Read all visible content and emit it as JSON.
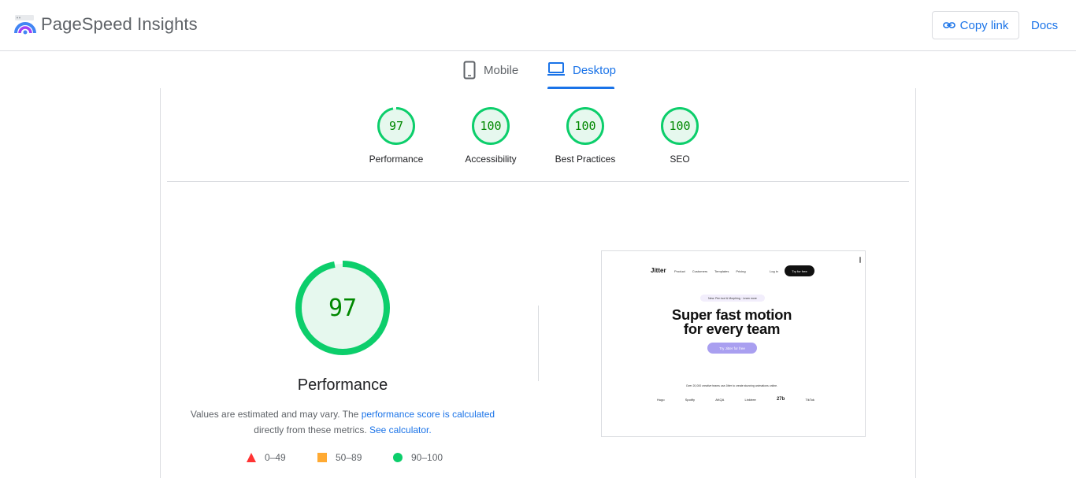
{
  "header": {
    "brand": "PageSpeed Insights",
    "copy_link_label": "Copy link",
    "docs_label": "Docs"
  },
  "tabs": [
    {
      "label": "Mobile",
      "active": false
    },
    {
      "label": "Desktop",
      "active": true
    }
  ],
  "categories": [
    {
      "score": "97",
      "label": "Performance"
    },
    {
      "score": "100",
      "label": "Accessibility"
    },
    {
      "score": "100",
      "label": "Best Practices"
    },
    {
      "score": "100",
      "label": "SEO"
    }
  ],
  "performance": {
    "score": "97",
    "title": "Performance",
    "desc_prefix": "Values are estimated and may vary. The",
    "desc_link1": "performance score is calculated",
    "desc_mid": "directly from these metrics.",
    "desc_link2": "See calculator."
  },
  "legend": [
    {
      "range": "0–49",
      "icon": "red-triangle-icon"
    },
    {
      "range": "50–89",
      "icon": "orange-square-icon"
    },
    {
      "range": "90–100",
      "icon": "green-circle-icon"
    }
  ],
  "thumbnail": {
    "logo": "Jitter",
    "nav": [
      "Product",
      "Customers",
      "Templates",
      "Pricing"
    ],
    "login": "Log in",
    "try_button": "Try for free",
    "pill": "New: Pen tool & Morphing · Learn more",
    "headline_line1": "Super fast motion",
    "headline_line2": "for every team",
    "cta": "Try Jitter for free",
    "social_proof": "Over 20,000 creative teams use Jitter to create stunning animations online.",
    "logos": [
      "Hugo",
      "Spotify",
      "AKQA",
      "Linktree",
      "27b",
      "TikTok"
    ]
  },
  "colors": {
    "accent": "#1a73e8",
    "pass_green": "#0cce6b",
    "pass_fill": "#e6f8ee",
    "pass_text": "#008800",
    "fail_red": "#ff3333",
    "average_orange": "#ffaa33"
  }
}
